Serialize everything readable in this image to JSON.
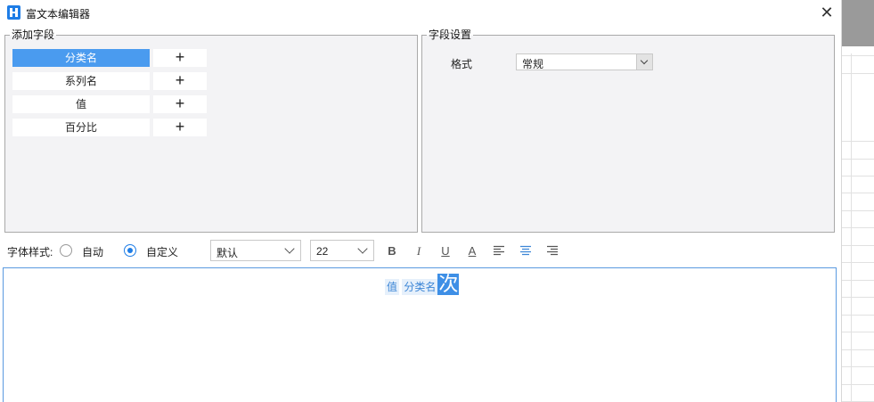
{
  "window": {
    "title": "富文本编辑器",
    "close_glyph": "✕"
  },
  "add_fields": {
    "legend": "添加字段",
    "items": [
      {
        "label": "分类名",
        "selected": true
      },
      {
        "label": "系列名",
        "selected": false
      },
      {
        "label": "值",
        "selected": false
      },
      {
        "label": "百分比",
        "selected": false
      }
    ],
    "add_glyph": "+"
  },
  "field_settings": {
    "legend": "字段设置",
    "format_label": "格式",
    "format_value": "常规"
  },
  "toolbar": {
    "font_style_label": "字体样式:",
    "radio_auto_label": "自动",
    "radio_custom_label": "自定义",
    "selected_radio": "custom",
    "font_family_value": "默认",
    "font_size_value": "22",
    "bold_glyph": "B",
    "italic_glyph": "I",
    "underline_glyph": "U",
    "color_glyph": "A",
    "icons": [
      "bold-icon",
      "italic-icon",
      "underline-icon",
      "font-color-icon",
      "align-left-icon",
      "align-center-icon",
      "align-right-icon"
    ]
  },
  "editor": {
    "tokens": [
      {
        "text": "值",
        "type": "field"
      },
      {
        "text": "分类名",
        "type": "field"
      },
      {
        "text": "次",
        "type": "selected-text"
      }
    ]
  },
  "colors": {
    "accent": "#1e7de6",
    "selection": "#4a9bef",
    "panel_bg": "#f3f3f5"
  }
}
